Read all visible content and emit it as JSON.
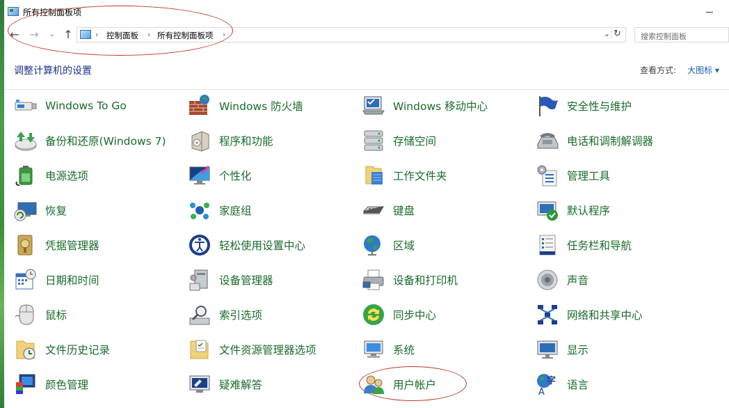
{
  "window": {
    "title": "所有控制面板项"
  },
  "address": {
    "crumbs": [
      "控制面板",
      "所有控制面板项"
    ],
    "search_placeholder": "搜索控制面板"
  },
  "header": {
    "title": "调整计算机的设置",
    "view_by_label": "查看方式:",
    "view_by_value": "大图标 ▾"
  },
  "items": [
    {
      "label": "Windows To Go",
      "icon": "usb-drive-icon"
    },
    {
      "label": "Windows 防火墙",
      "icon": "firewall-icon"
    },
    {
      "label": "Windows 移动中心",
      "icon": "mobility-center-icon"
    },
    {
      "label": "安全性与维护",
      "icon": "flag-icon"
    },
    {
      "label": "备份和还原(Windows 7)",
      "icon": "backup-icon"
    },
    {
      "label": "程序和功能",
      "icon": "programs-icon"
    },
    {
      "label": "存储空间",
      "icon": "storage-icon"
    },
    {
      "label": "电话和调制解调器",
      "icon": "phone-modem-icon"
    },
    {
      "label": "电源选项",
      "icon": "power-icon"
    },
    {
      "label": "个性化",
      "icon": "personalization-icon"
    },
    {
      "label": "工作文件夹",
      "icon": "work-folders-icon"
    },
    {
      "label": "管理工具",
      "icon": "admin-tools-icon"
    },
    {
      "label": "恢复",
      "icon": "recovery-icon"
    },
    {
      "label": "家庭组",
      "icon": "homegroup-icon"
    },
    {
      "label": "键盘",
      "icon": "keyboard-icon"
    },
    {
      "label": "默认程序",
      "icon": "default-programs-icon"
    },
    {
      "label": "凭据管理器",
      "icon": "credential-icon"
    },
    {
      "label": "轻松使用设置中心",
      "icon": "ease-of-access-icon"
    },
    {
      "label": "区域",
      "icon": "region-icon"
    },
    {
      "label": "任务栏和导航",
      "icon": "taskbar-icon"
    },
    {
      "label": "日期和时间",
      "icon": "datetime-icon"
    },
    {
      "label": "设备管理器",
      "icon": "device-manager-icon"
    },
    {
      "label": "设备和打印机",
      "icon": "printer-icon"
    },
    {
      "label": "声音",
      "icon": "sound-icon"
    },
    {
      "label": "鼠标",
      "icon": "mouse-icon"
    },
    {
      "label": "索引选项",
      "icon": "indexing-icon"
    },
    {
      "label": "同步中心",
      "icon": "sync-icon"
    },
    {
      "label": "网络和共享中心",
      "icon": "network-icon"
    },
    {
      "label": "文件历史记录",
      "icon": "file-history-icon"
    },
    {
      "label": "文件资源管理器选项",
      "icon": "explorer-options-icon"
    },
    {
      "label": "系统",
      "icon": "system-icon"
    },
    {
      "label": "显示",
      "icon": "display-icon"
    },
    {
      "label": "颜色管理",
      "icon": "color-management-icon"
    },
    {
      "label": "疑难解答",
      "icon": "troubleshooting-icon"
    },
    {
      "label": "用户帐户",
      "icon": "user-accounts-icon"
    },
    {
      "label": "语言",
      "icon": "language-icon"
    }
  ]
}
